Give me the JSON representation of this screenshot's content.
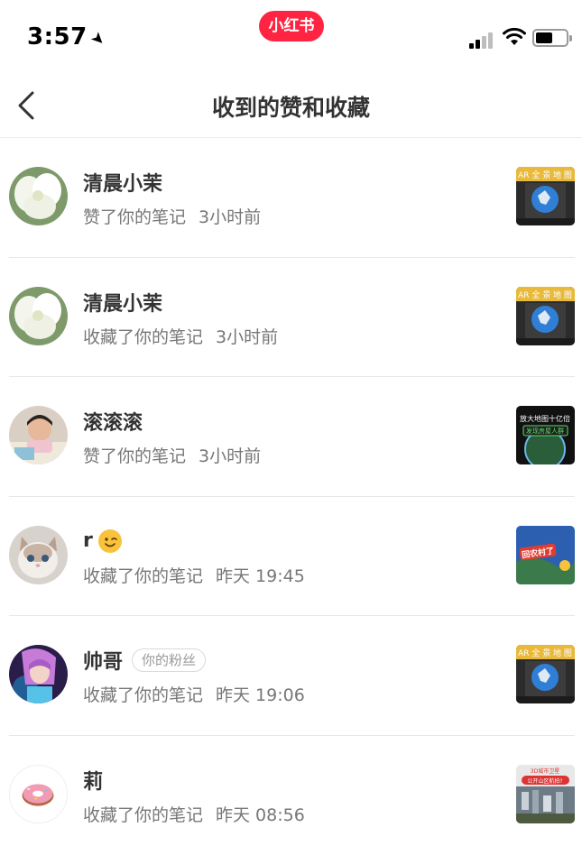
{
  "status": {
    "time": "3:57",
    "app_badge": "小红书"
  },
  "nav": {
    "title": "收到的赞和收藏"
  },
  "notifications": [
    {
      "name": "清晨小茉",
      "action": "赞了你的笔记",
      "time": "3小时前",
      "avatar_icon": "white-flower-avatar",
      "thumb_icon": "ar-earth-map-thumbnail",
      "thumb_text": "AR 全 景 地 图"
    },
    {
      "name": "清晨小茉",
      "action": "收藏了你的笔记",
      "time": "3小时前",
      "avatar_icon": "white-flower-avatar",
      "thumb_icon": "ar-earth-map-thumbnail",
      "thumb_text": "AR 全 景 地 图"
    },
    {
      "name": "滚滚滚",
      "action": "赞了你的笔记",
      "time": "3小时前",
      "avatar_icon": "child-photo-avatar",
      "thumb_icon": "earth-map-thumbnail",
      "thumb_text": "放大地图十亿倍",
      "thumb_text2": "发现房屋人群"
    },
    {
      "name": "r",
      "action": "收藏了你的笔记",
      "time": "昨天 19:45",
      "avatar_icon": "cat-avatar",
      "thumb_icon": "blue-map-thumbnail",
      "thumb_text": "回农村了",
      "emoji": "wink-emoji-icon"
    },
    {
      "name": "帅哥",
      "action": "收藏了你的笔记",
      "time": "昨天 19:06",
      "avatar_icon": "game-character-avatar",
      "thumb_icon": "ar-earth-map-thumbnail",
      "thumb_text": "AR 全 景 地 图",
      "badge": "你的粉丝"
    },
    {
      "name": "莉",
      "action": "收藏了你的笔记",
      "time": "昨天 08:56",
      "avatar_icon": "donut-avatar",
      "thumb_icon": "city-aerial-thumbnail",
      "thumb_text": "3D城市卫星",
      "thumb_text2": "公开山区航拍?"
    }
  ],
  "colors": {
    "brand_red": "#ff2442",
    "title_text": "#333333",
    "sub_text": "#777777"
  }
}
